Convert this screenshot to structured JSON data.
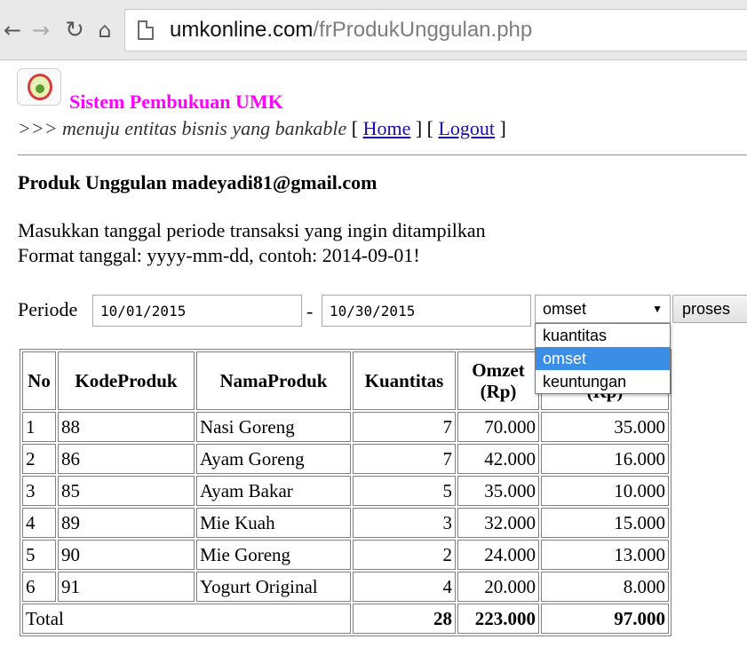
{
  "browser": {
    "url_host": "umkonline.com",
    "url_path": "/frProdukUnggulan.php",
    "icons": [
      "back-icon",
      "forward-icon",
      "reload-icon",
      "home-icon",
      "page-icon"
    ]
  },
  "header": {
    "app_title": "Sistem Pembukuan UMK",
    "tagline_prefix": ">>>",
    "tagline_text": "menuju entitas bisnis yang bankable",
    "home_link": "Home",
    "logout_link": "Logout"
  },
  "main": {
    "heading": "Produk Unggulan madeyadi81@gmail.com",
    "instruction_1": "Masukkan tanggal periode transaksi yang ingin ditampilkan",
    "instruction_2": "Format tanggal: yyyy-mm-dd, contoh: 2014-09-01!"
  },
  "form": {
    "periode_label": "Periode",
    "start_date": "10/01/2015",
    "separator": "-",
    "end_date": "10/30/2015",
    "select_value": "omset",
    "select_options": [
      "kuantitas",
      "omset",
      "keuntungan"
    ],
    "selected_index": 1,
    "submit_label": "proses"
  },
  "table": {
    "headers": [
      "No",
      "KodeProduk",
      "NamaProduk",
      "Kuantitas",
      "Omzet (Rp)",
      "Keuntungan (Rp)"
    ],
    "rows": [
      {
        "no": "1",
        "kode": "88",
        "nama": "Nasi Goreng",
        "qty": "7",
        "omzet": "70.000",
        "untung": "35.000"
      },
      {
        "no": "2",
        "kode": "86",
        "nama": "Ayam Goreng",
        "qty": "7",
        "omzet": "42.000",
        "untung": "16.000"
      },
      {
        "no": "3",
        "kode": "85",
        "nama": "Ayam Bakar",
        "qty": "5",
        "omzet": "35.000",
        "untung": "10.000"
      },
      {
        "no": "4",
        "kode": "89",
        "nama": "Mie Kuah",
        "qty": "3",
        "omzet": "32.000",
        "untung": "15.000"
      },
      {
        "no": "5",
        "kode": "90",
        "nama": "Mie Goreng",
        "qty": "2",
        "omzet": "24.000",
        "untung": "13.000"
      },
      {
        "no": "6",
        "kode": "91",
        "nama": "Yogurt Original",
        "qty": "4",
        "omzet": "20.000",
        "untung": "8.000"
      }
    ],
    "total": {
      "label": "Total",
      "qty": "28",
      "omzet": "223.000",
      "untung": "97.000"
    }
  }
}
